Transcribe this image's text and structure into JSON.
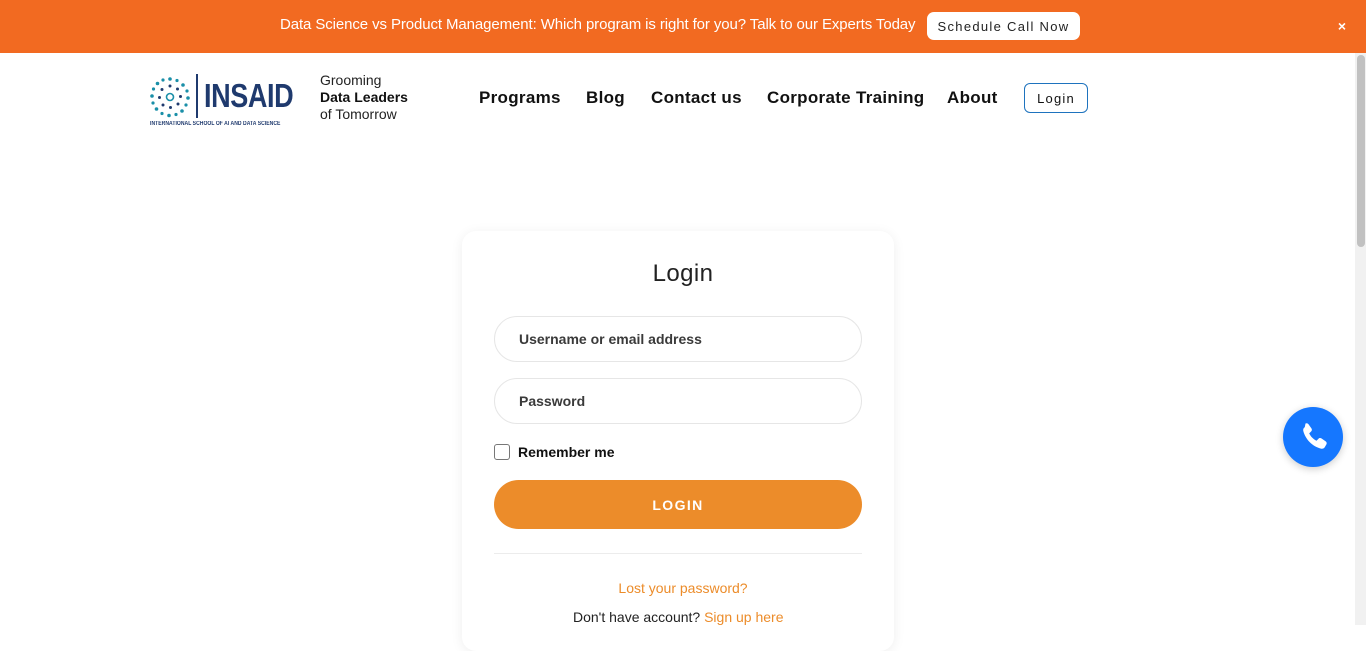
{
  "promo": {
    "text": "Data Science vs Product Management: Which program is right for you? Talk to our Experts Today",
    "cta_label": "Schedule Call Now",
    "close_label": "×",
    "bg_color": "#f26a21"
  },
  "header": {
    "logo": {
      "word": "INSAID",
      "subtitle": "INTERNATIONAL SCHOOL OF AI AND DATA SCIENCE"
    },
    "tagline": {
      "line1": "Grooming",
      "line2": "Data Leaders",
      "line3": "of Tomorrow"
    },
    "nav": [
      {
        "label": "Programs"
      },
      {
        "label": "Blog"
      },
      {
        "label": "Contact us"
      },
      {
        "label": "Corporate Training"
      },
      {
        "label": "About"
      }
    ],
    "login_label": "Login"
  },
  "login_form": {
    "title": "Login",
    "username_placeholder": "Username or email address",
    "password_placeholder": "Password",
    "remember_label": "Remember me",
    "submit_label": "LOGIN",
    "lost_password": "Lost your password?",
    "no_account_text": "Don't have account?",
    "signup_link": "Sign up here",
    "accent_color": "#ec8c2a"
  },
  "floating": {
    "icon": "phone-icon",
    "color": "#1577ff"
  }
}
